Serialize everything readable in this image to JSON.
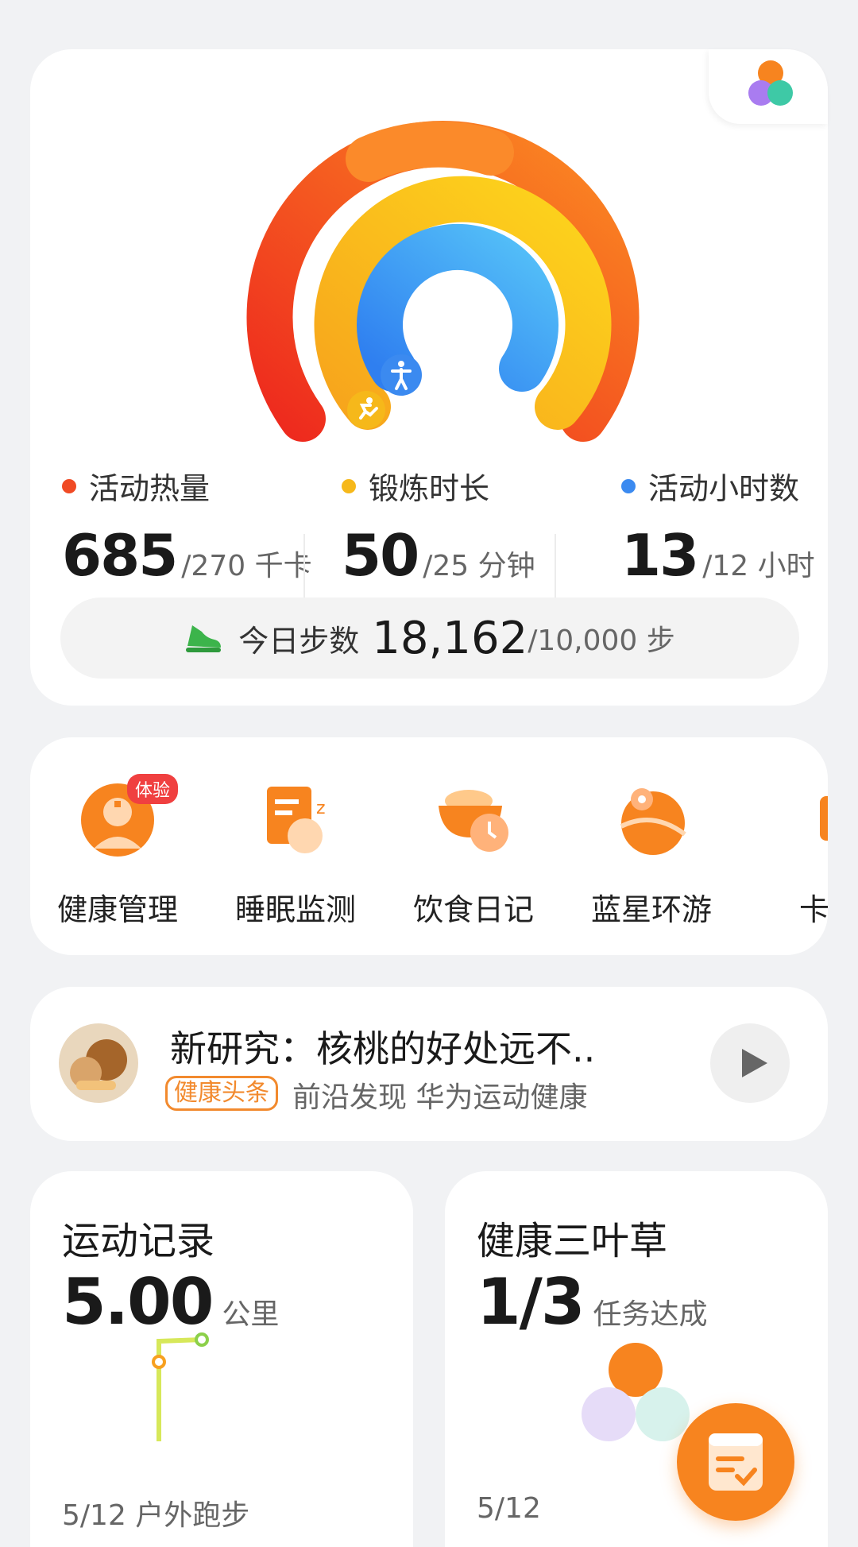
{
  "colors": {
    "calories": "#f04a24",
    "exercise": "#f6b81a",
    "stand": "#3b8af0",
    "steps_icon": "#3cb44b",
    "accent": "#f7841f"
  },
  "rings": [
    {
      "name": "calories",
      "icon": "flame-icon",
      "progress": 2.54
    },
    {
      "name": "exercise",
      "icon": "running-icon",
      "progress": 2.0
    },
    {
      "name": "stand",
      "icon": "person-standing-icon",
      "progress": 1.08
    }
  ],
  "metrics": [
    {
      "label": "活动热量",
      "value": "685",
      "goal": "/270 千卡"
    },
    {
      "label": "锻炼时长",
      "value": "50",
      "goal": "/25 分钟"
    },
    {
      "label": "活动小时数",
      "value": "13",
      "goal": "/12 小时"
    }
  ],
  "steps": {
    "label": "今日步数",
    "value": "18,162",
    "goal": "/10,000 步",
    "icon": "sneaker-icon"
  },
  "shortcuts": [
    {
      "label": "健康管理",
      "badge": "体验",
      "icon": "doctor-icon"
    },
    {
      "label": "睡眠监测",
      "icon": "sleep-icon"
    },
    {
      "label": "饮食日记",
      "icon": "meal-clock-icon"
    },
    {
      "label": "蓝星环游",
      "icon": "globe-pin-icon"
    },
    {
      "label": "卡卡",
      "icon": "card-icon"
    }
  ],
  "news": {
    "title": "新研究：核桃的好处远不..",
    "tag": "健康头条",
    "source": "前沿发现 华为运动健康"
  },
  "record": {
    "title": "运动记录",
    "value": "5.00",
    "unit": "公里",
    "date": "5/12 户外跑步"
  },
  "clover": {
    "title": "健康三叶草",
    "value": "1/3",
    "unit": "任务达成",
    "date": "5/12"
  }
}
